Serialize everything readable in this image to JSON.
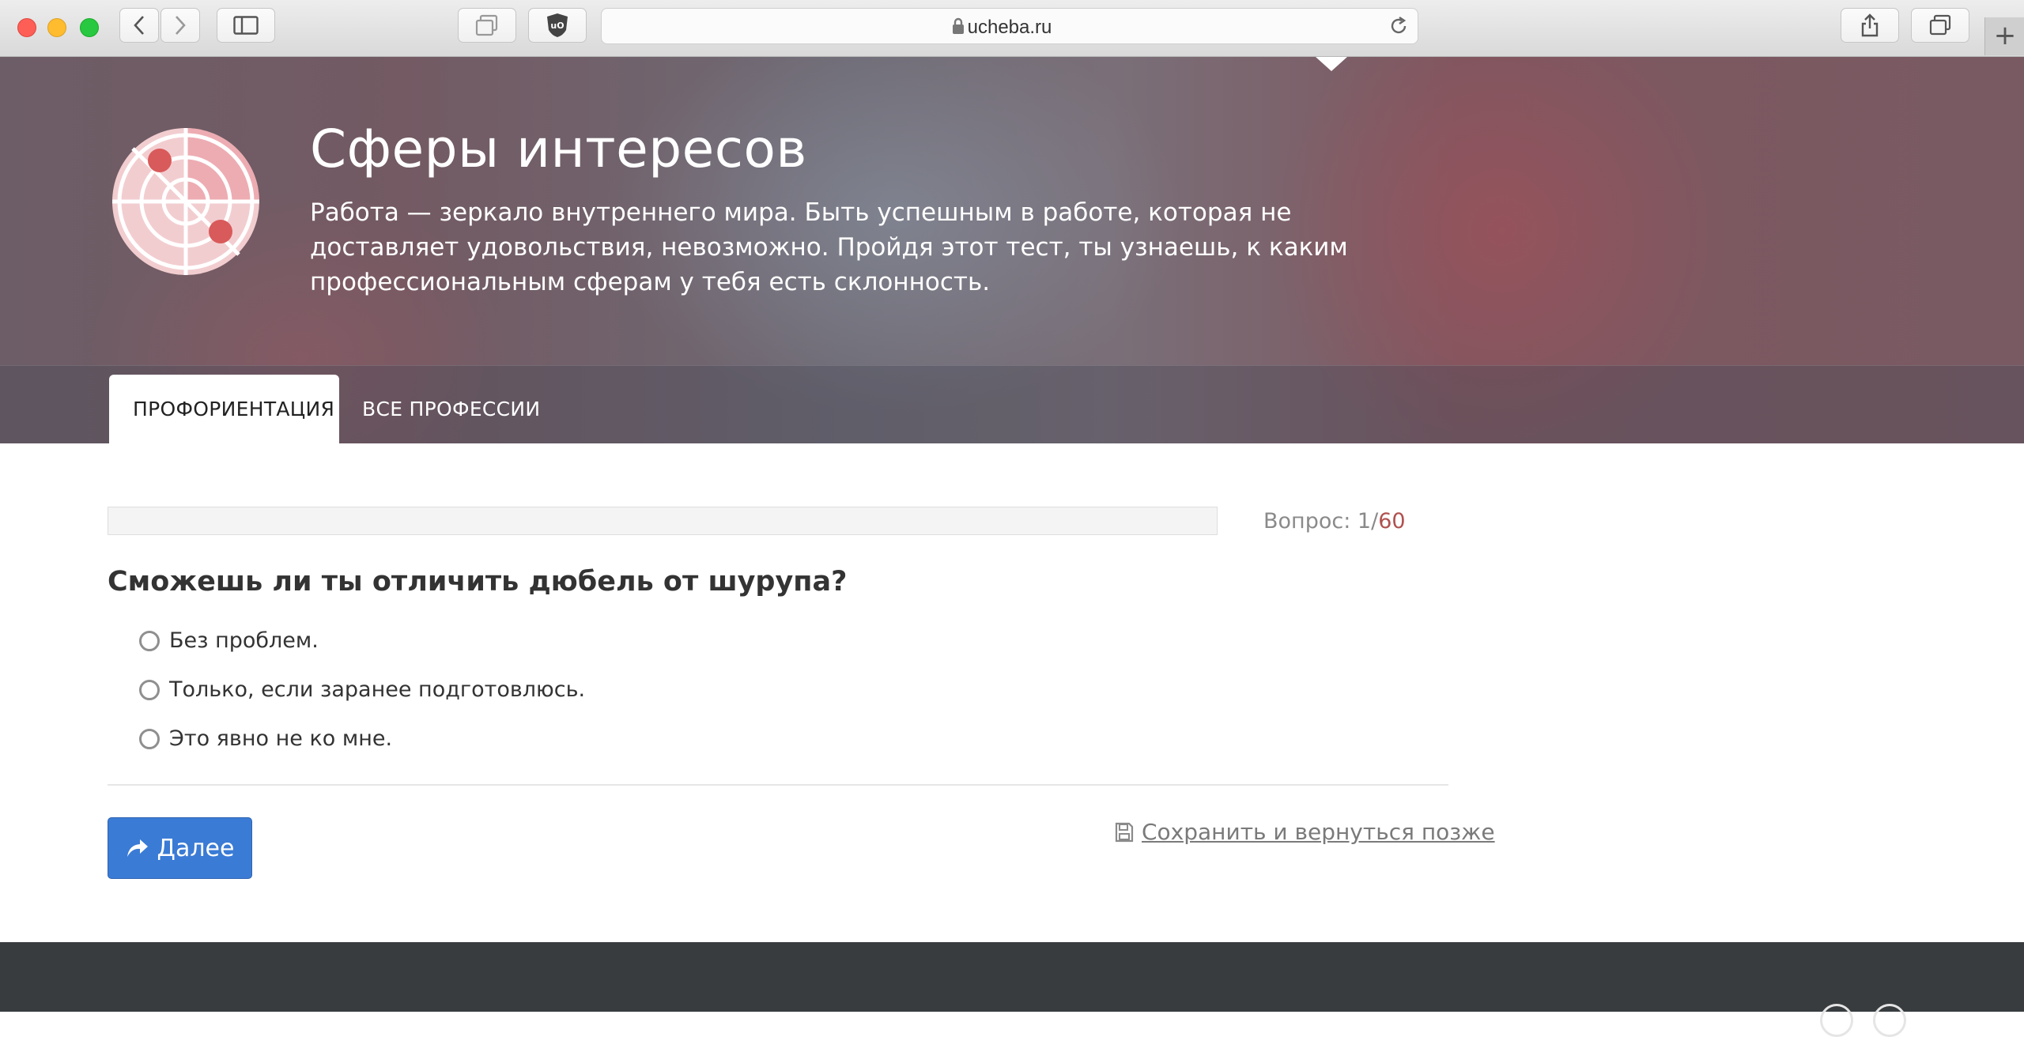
{
  "browser": {
    "url": "ucheba.ru",
    "icons": [
      "back-icon",
      "forward-icon",
      "sidebar-icon",
      "tabs-icon",
      "ublock-icon",
      "lock-icon",
      "reload-icon",
      "share-icon",
      "tab-overview-icon",
      "new-tab-icon"
    ],
    "new_tab_label": "+"
  },
  "hero": {
    "title": "Сферы интересов",
    "description": "Работа — зеркало внутреннего мира. Быть успешным в работе, которая не доставляет удовольствия, невозможно. Пройдя этот тест, ты узнаешь, к каким профессиональным сферам у тебя есть склонность.",
    "tabs": [
      {
        "label": "ПРОФОРИЕНТАЦИЯ",
        "active": true
      },
      {
        "label": "ВСЕ ПРОФЕССИИ",
        "active": false
      }
    ]
  },
  "quiz": {
    "progress_fraction": 0.0,
    "question_label": "Вопрос:",
    "current": "1",
    "separator": "/",
    "total": "60",
    "question": "Сможешь ли ты отличить дюбель от шурупа?",
    "options": [
      "Без проблем.",
      "Только, если заранее подготовлюсь.",
      "Это явно не ко мне."
    ],
    "next_label": "Далее",
    "save_label": "Сохранить и вернуться позже"
  },
  "colors": {
    "accent": "#3a7bd5",
    "total_highlight": "#b0514f",
    "footer": "#383c3f"
  }
}
